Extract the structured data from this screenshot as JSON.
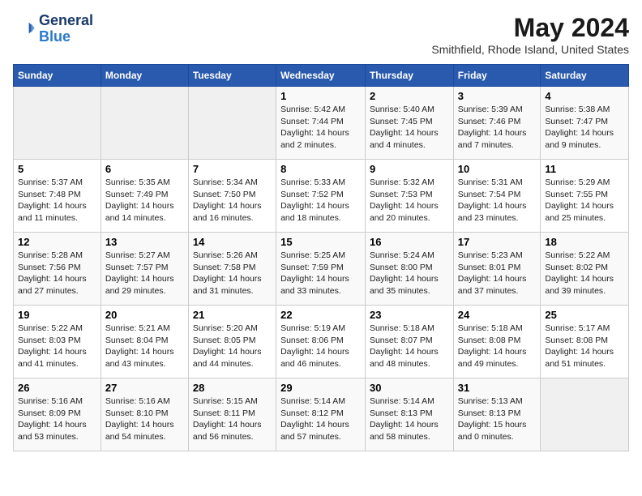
{
  "logo": {
    "text_general": "General",
    "text_blue": "Blue"
  },
  "title": "May 2024",
  "location": "Smithfield, Rhode Island, United States",
  "weekdays": [
    "Sunday",
    "Monday",
    "Tuesday",
    "Wednesday",
    "Thursday",
    "Friday",
    "Saturday"
  ],
  "weeks": [
    [
      {
        "day": "",
        "empty": true
      },
      {
        "day": "",
        "empty": true
      },
      {
        "day": "",
        "empty": true
      },
      {
        "day": "1",
        "sunrise": "5:42 AM",
        "sunset": "7:44 PM",
        "daylight": "14 hours and 2 minutes."
      },
      {
        "day": "2",
        "sunrise": "5:40 AM",
        "sunset": "7:45 PM",
        "daylight": "14 hours and 4 minutes."
      },
      {
        "day": "3",
        "sunrise": "5:39 AM",
        "sunset": "7:46 PM",
        "daylight": "14 hours and 7 minutes."
      },
      {
        "day": "4",
        "sunrise": "5:38 AM",
        "sunset": "7:47 PM",
        "daylight": "14 hours and 9 minutes."
      }
    ],
    [
      {
        "day": "5",
        "sunrise": "5:37 AM",
        "sunset": "7:48 PM",
        "daylight": "14 hours and 11 minutes."
      },
      {
        "day": "6",
        "sunrise": "5:35 AM",
        "sunset": "7:49 PM",
        "daylight": "14 hours and 14 minutes."
      },
      {
        "day": "7",
        "sunrise": "5:34 AM",
        "sunset": "7:50 PM",
        "daylight": "14 hours and 16 minutes."
      },
      {
        "day": "8",
        "sunrise": "5:33 AM",
        "sunset": "7:52 PM",
        "daylight": "14 hours and 18 minutes."
      },
      {
        "day": "9",
        "sunrise": "5:32 AM",
        "sunset": "7:53 PM",
        "daylight": "14 hours and 20 minutes."
      },
      {
        "day": "10",
        "sunrise": "5:31 AM",
        "sunset": "7:54 PM",
        "daylight": "14 hours and 23 minutes."
      },
      {
        "day": "11",
        "sunrise": "5:29 AM",
        "sunset": "7:55 PM",
        "daylight": "14 hours and 25 minutes."
      }
    ],
    [
      {
        "day": "12",
        "sunrise": "5:28 AM",
        "sunset": "7:56 PM",
        "daylight": "14 hours and 27 minutes."
      },
      {
        "day": "13",
        "sunrise": "5:27 AM",
        "sunset": "7:57 PM",
        "daylight": "14 hours and 29 minutes."
      },
      {
        "day": "14",
        "sunrise": "5:26 AM",
        "sunset": "7:58 PM",
        "daylight": "14 hours and 31 minutes."
      },
      {
        "day": "15",
        "sunrise": "5:25 AM",
        "sunset": "7:59 PM",
        "daylight": "14 hours and 33 minutes."
      },
      {
        "day": "16",
        "sunrise": "5:24 AM",
        "sunset": "8:00 PM",
        "daylight": "14 hours and 35 minutes."
      },
      {
        "day": "17",
        "sunrise": "5:23 AM",
        "sunset": "8:01 PM",
        "daylight": "14 hours and 37 minutes."
      },
      {
        "day": "18",
        "sunrise": "5:22 AM",
        "sunset": "8:02 PM",
        "daylight": "14 hours and 39 minutes."
      }
    ],
    [
      {
        "day": "19",
        "sunrise": "5:22 AM",
        "sunset": "8:03 PM",
        "daylight": "14 hours and 41 minutes."
      },
      {
        "day": "20",
        "sunrise": "5:21 AM",
        "sunset": "8:04 PM",
        "daylight": "14 hours and 43 minutes."
      },
      {
        "day": "21",
        "sunrise": "5:20 AM",
        "sunset": "8:05 PM",
        "daylight": "14 hours and 44 minutes."
      },
      {
        "day": "22",
        "sunrise": "5:19 AM",
        "sunset": "8:06 PM",
        "daylight": "14 hours and 46 minutes."
      },
      {
        "day": "23",
        "sunrise": "5:18 AM",
        "sunset": "8:07 PM",
        "daylight": "14 hours and 48 minutes."
      },
      {
        "day": "24",
        "sunrise": "5:18 AM",
        "sunset": "8:08 PM",
        "daylight": "14 hours and 49 minutes."
      },
      {
        "day": "25",
        "sunrise": "5:17 AM",
        "sunset": "8:08 PM",
        "daylight": "14 hours and 51 minutes."
      }
    ],
    [
      {
        "day": "26",
        "sunrise": "5:16 AM",
        "sunset": "8:09 PM",
        "daylight": "14 hours and 53 minutes."
      },
      {
        "day": "27",
        "sunrise": "5:16 AM",
        "sunset": "8:10 PM",
        "daylight": "14 hours and 54 minutes."
      },
      {
        "day": "28",
        "sunrise": "5:15 AM",
        "sunset": "8:11 PM",
        "daylight": "14 hours and 56 minutes."
      },
      {
        "day": "29",
        "sunrise": "5:14 AM",
        "sunset": "8:12 PM",
        "daylight": "14 hours and 57 minutes."
      },
      {
        "day": "30",
        "sunrise": "5:14 AM",
        "sunset": "8:13 PM",
        "daylight": "14 hours and 58 minutes."
      },
      {
        "day": "31",
        "sunrise": "5:13 AM",
        "sunset": "8:13 PM",
        "daylight": "15 hours and 0 minutes."
      },
      {
        "day": "",
        "empty": true
      }
    ]
  ]
}
